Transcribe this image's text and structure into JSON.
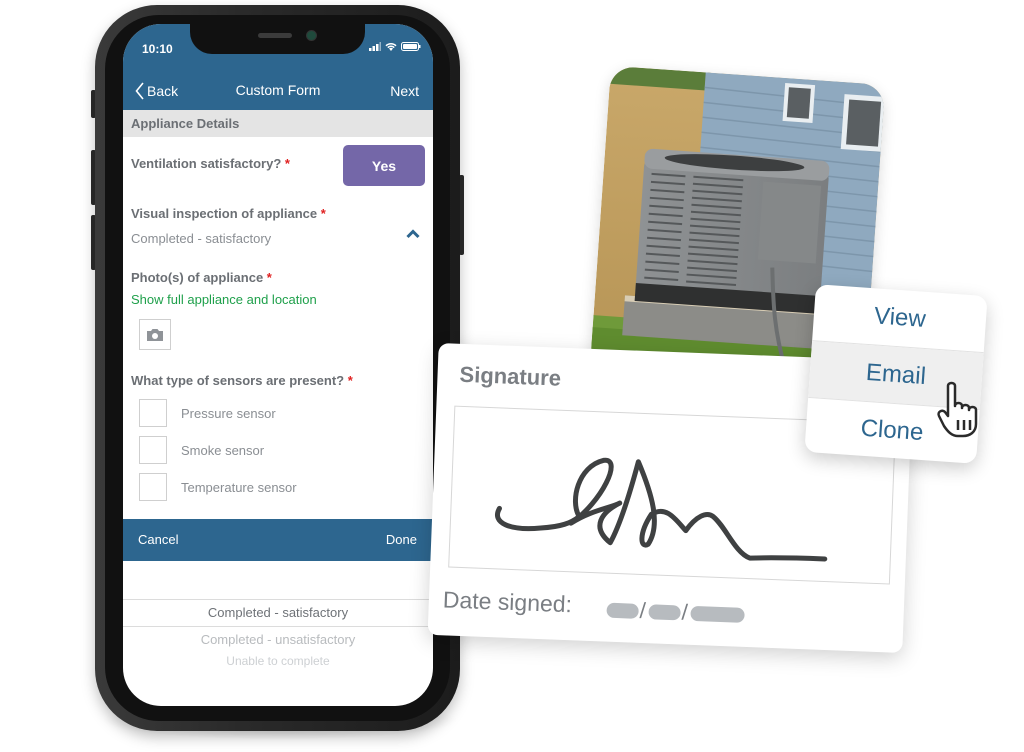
{
  "phone": {
    "status_bar": {
      "time": "10:10"
    },
    "nav": {
      "back_label": "Back",
      "title": "Custom Form",
      "next_label": "Next"
    },
    "section_header": "Appliance Details",
    "fields": {
      "ventilation": {
        "label": "Ventilation satisfactory?",
        "required_mark": "*",
        "value": "Yes"
      },
      "visual_inspection": {
        "label": "Visual inspection of appliance",
        "required_mark": "*",
        "value": "Completed - satisfactory"
      },
      "photos": {
        "label": "Photo(s) of appliance",
        "required_mark": "*",
        "hint": "Show full appliance and location"
      },
      "sensors": {
        "label": "What type of sensors are present?",
        "required_mark": "*",
        "options": [
          {
            "label": "Pressure sensor",
            "checked": false
          },
          {
            "label": "Smoke sensor",
            "checked": false
          },
          {
            "label": "Temperature sensor",
            "checked": false
          }
        ]
      }
    },
    "picker": {
      "cancel_label": "Cancel",
      "done_label": "Done",
      "options": [
        "Completed - satisfactory",
        "Completed - unsatisfactory",
        "Unable to complete"
      ],
      "selected": "Completed - satisfactory"
    }
  },
  "signature_card": {
    "title": "Signature",
    "date_label": "Date signed:",
    "date_separator": "/"
  },
  "action_menu": {
    "items": [
      "View",
      "Email",
      "Clone"
    ],
    "hovered": "Email"
  },
  "colors": {
    "brand_blue": "#2d668f",
    "yes_purple": "#7467a8",
    "hint_green": "#1fa04b",
    "required_red": "#e02020"
  }
}
